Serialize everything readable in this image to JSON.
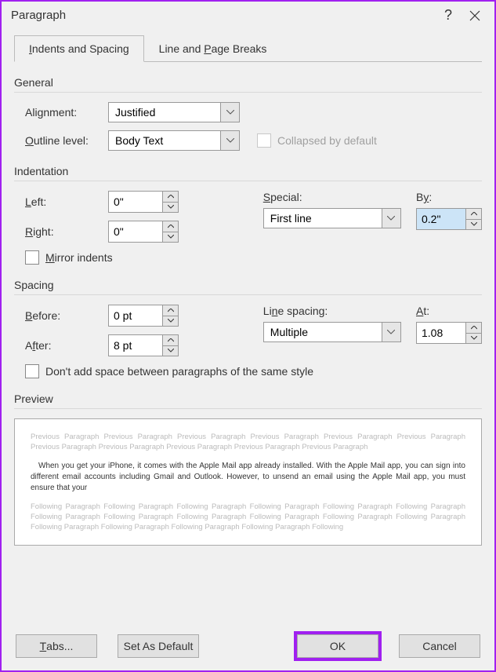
{
  "title": "Paragraph",
  "tabs": {
    "t1": "Indents and Spacing",
    "t2": "Line and Page Breaks"
  },
  "general": {
    "heading": "General",
    "alignment_label_pre": "Ali",
    "alignment_label_u": "g",
    "alignment_label_post": "nment:",
    "alignment_value": "Justified",
    "outline_label_u": "O",
    "outline_label_post": "utline level:",
    "outline_value": "Body Text",
    "collapsed_label": "Collapsed by default"
  },
  "indentation": {
    "heading": "Indentation",
    "left_u": "L",
    "left_post": "eft:",
    "left_val": "0\"",
    "right_u": "R",
    "right_post": "ight:",
    "right_val": "0\"",
    "special_u": "S",
    "special_post": "pecial:",
    "special_value": "First line",
    "by_label_pre": "B",
    "by_label_u": "y",
    "by_label_post": ":",
    "by_val": "0.2\"",
    "mirror_u": "M",
    "mirror_post": "irror indents"
  },
  "spacing": {
    "heading": "Spacing",
    "before_u": "B",
    "before_post": "efore:",
    "before_val": "0 pt",
    "after_label_pre": "A",
    "after_u": "f",
    "after_post": "ter:",
    "after_val": "8 pt",
    "line_label_pre": "Li",
    "line_u": "n",
    "line_post": "e spacing:",
    "line_value": "Multiple",
    "at_u": "A",
    "at_post": "t:",
    "at_val": "1.08",
    "dontadd_label": "Don't add space between paragraphs of the same style"
  },
  "preview": {
    "heading": "Preview",
    "prev_text": "Previous Paragraph Previous Paragraph Previous Paragraph Previous Paragraph Previous Paragraph Previous Paragraph Previous Paragraph Previous Paragraph Previous Paragraph Previous Paragraph Previous Paragraph",
    "body_text": "When you get your iPhone, it comes with the Apple Mail app already installed. With the Apple Mail app, you can sign into different email accounts including Gmail and Outlook. However, to unsend an email using the Apple Mail app, you must ensure that your",
    "follow_text": "Following Paragraph Following Paragraph Following Paragraph Following Paragraph Following Paragraph Following Paragraph Following Paragraph Following Paragraph Following Paragraph Following Paragraph Following Paragraph Following Paragraph Following Paragraph Following Paragraph Following Paragraph Following Paragraph Following"
  },
  "footer": {
    "tabs_u": "T",
    "tabs_post": "abs...",
    "default_label": "Set As Default",
    "ok": "OK",
    "cancel": "Cancel"
  }
}
